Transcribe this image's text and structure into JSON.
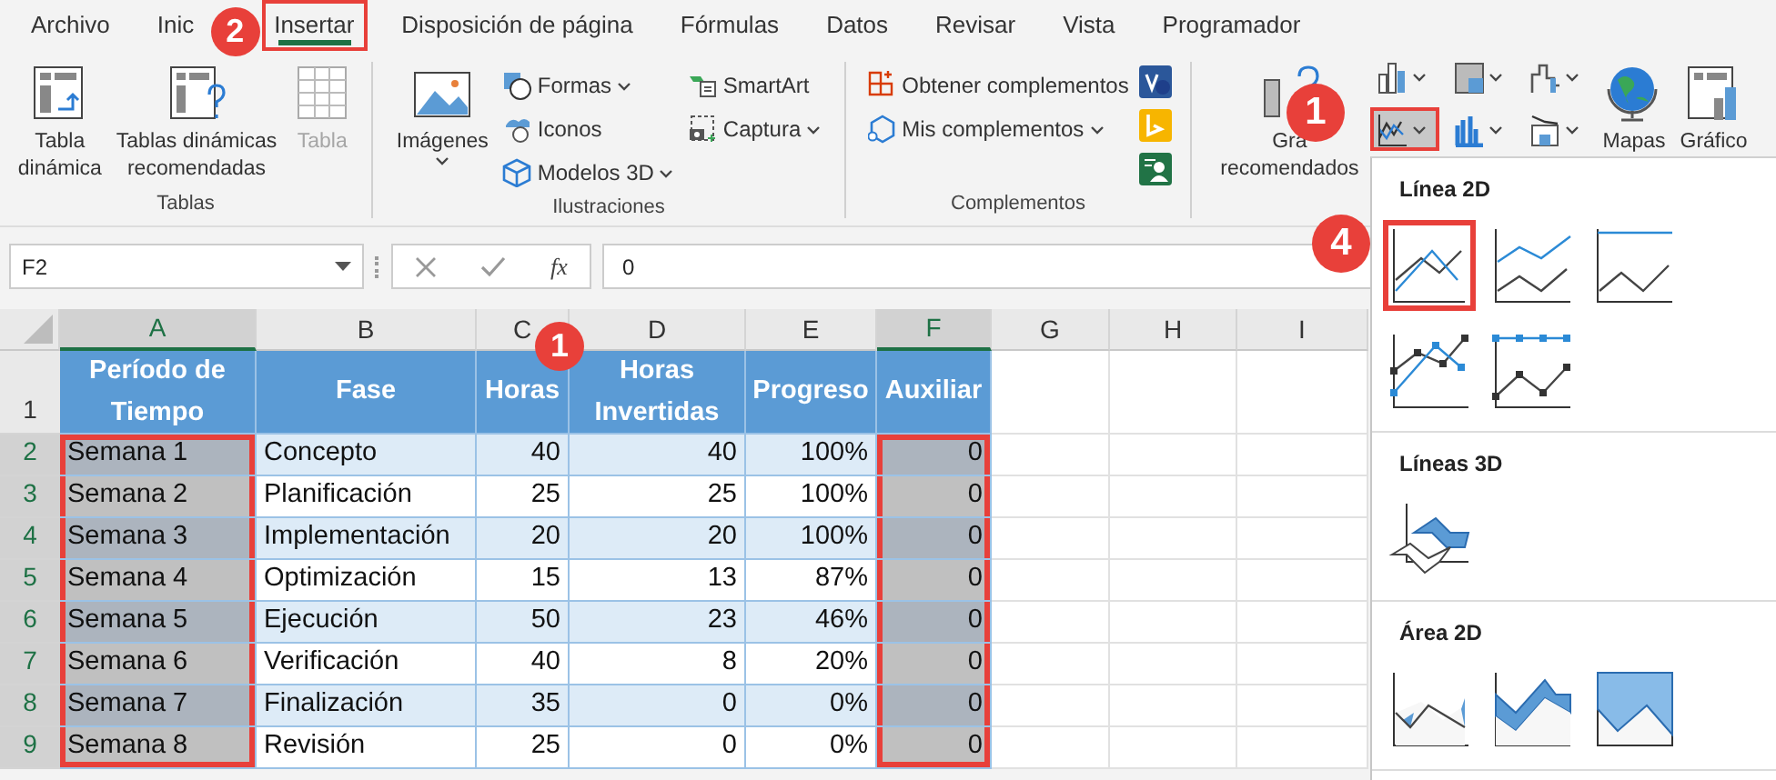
{
  "tabs": [
    {
      "label": "Archivo",
      "selected": false
    },
    {
      "label": "Inic",
      "selected": false
    },
    {
      "label": "Insertar",
      "selected": true
    },
    {
      "label": "Disposición de página",
      "selected": false
    },
    {
      "label": "Fórmulas",
      "selected": false
    },
    {
      "label": "Datos",
      "selected": false
    },
    {
      "label": "Revisar",
      "selected": false
    },
    {
      "label": "Vista",
      "selected": false
    },
    {
      "label": "Programador",
      "selected": false
    }
  ],
  "ribbon": {
    "groups": [
      {
        "label": "Tablas",
        "items": [
          {
            "kind": "large",
            "lines": [
              "Tabla",
              "dinámica"
            ],
            "disabled": false,
            "menu": false
          },
          {
            "kind": "large",
            "lines": [
              "Tablas dinámicas",
              "recomendadas"
            ],
            "disabled": false,
            "menu": false
          },
          {
            "kind": "large",
            "lines": [
              "Tabla"
            ],
            "disabled": true,
            "menu": false
          }
        ]
      },
      {
        "label": "Ilustraciones",
        "items": [
          {
            "kind": "large",
            "lines": [
              "Imágenes"
            ],
            "disabled": false,
            "menu": true
          },
          {
            "kind": "stack",
            "entries": [
              {
                "label": "Formas",
                "menu": true
              },
              {
                "label": "Iconos",
                "menu": false
              },
              {
                "label": "Modelos 3D",
                "menu": true
              }
            ]
          },
          {
            "kind": "stack",
            "entries": [
              {
                "label": "SmartArt",
                "menu": false
              },
              {
                "label": "Captura",
                "menu": true
              }
            ]
          }
        ]
      },
      {
        "label": "Complementos",
        "items": [
          {
            "kind": "stack",
            "entries": [
              {
                "label": "Obtener complementos",
                "menu": false
              },
              {
                "label": "Mis complementos",
                "menu": true
              }
            ]
          },
          {
            "kind": "apps"
          }
        ]
      },
      {
        "items": [
          {
            "kind": "large",
            "lines": [
              "Grá",
              "recomendados"
            ],
            "disabled": false,
            "menu": false
          },
          {
            "kind": "chart_grid",
            "buttons": [
              {
                "selected": false
              },
              {
                "selected": false
              },
              {
                "selected": false
              },
              {
                "selected": true
              },
              {
                "selected": false
              },
              {
                "selected": false
              }
            ]
          },
          {
            "kind": "large",
            "lines": [
              "Mapas"
            ],
            "disabled": false
          },
          {
            "kind": "large",
            "lines": [
              "Gráfico"
            ],
            "disabled": false
          }
        ]
      }
    ]
  },
  "formula_bar": {
    "name_box": "F2",
    "fx": "fx",
    "value": "0"
  },
  "sheet": {
    "columns": [
      {
        "label": "A",
        "selected": true
      },
      {
        "label": "B",
        "selected": false
      },
      {
        "label": "C",
        "selected": false
      },
      {
        "label": "D",
        "selected": false
      },
      {
        "label": "E",
        "selected": false
      },
      {
        "label": "F",
        "selected": true
      },
      {
        "label": "G",
        "selected": false
      },
      {
        "label": "H",
        "selected": false
      },
      {
        "label": "I",
        "selected": false
      }
    ],
    "rows": [
      {
        "header": "1",
        "selected": false,
        "cells": [
          "Período de Tiempo",
          "Fase",
          "Horas",
          "Horas Invertidas",
          "Progreso",
          "Auxiliar"
        ]
      },
      {
        "header": "2",
        "selected": true,
        "cells": [
          "Semana 1",
          "Concepto",
          "40",
          "40",
          "100%",
          "0"
        ]
      },
      {
        "header": "3",
        "selected": true,
        "cells": [
          "Semana 2",
          "Planificación",
          "25",
          "25",
          "100%",
          "0"
        ]
      },
      {
        "header": "4",
        "selected": true,
        "cells": [
          "Semana 3",
          "Implementación",
          "20",
          "20",
          "100%",
          "0"
        ]
      },
      {
        "header": "5",
        "selected": true,
        "cells": [
          "Semana 4",
          "Optimización",
          "15",
          "13",
          "87%",
          "0"
        ]
      },
      {
        "header": "6",
        "selected": true,
        "cells": [
          "Semana 5",
          "Ejecución",
          "50",
          "23",
          "46%",
          "0"
        ]
      },
      {
        "header": "7",
        "selected": true,
        "cells": [
          "Semana 6",
          "Verificación",
          "40",
          "8",
          "20%",
          "0"
        ]
      },
      {
        "header": "8",
        "selected": true,
        "cells": [
          "Semana 7",
          "Finalización",
          "35",
          "0",
          "0%",
          "0"
        ]
      },
      {
        "header": "9",
        "selected": true,
        "cells": [
          "Semana 8",
          "Revisión",
          "25",
          "0",
          "0%",
          "0"
        ]
      }
    ]
  },
  "chart_menu": {
    "sections": [
      {
        "title": "Línea 2D",
        "options": [
          {
            "selected": true
          },
          {
            "selected": false
          },
          {
            "selected": false
          },
          {
            "selected": false
          },
          {
            "selected": false
          }
        ]
      },
      {
        "title": "Líneas 3D",
        "options": [
          {
            "selected": false
          }
        ]
      },
      {
        "title": "Área 2D",
        "options": [
          {
            "selected": false
          },
          {
            "selected": false
          },
          {
            "selected": false
          }
        ]
      }
    ]
  },
  "callouts": [
    {
      "label": "2"
    },
    {
      "label": "1"
    },
    {
      "label": "4"
    },
    {
      "label": "1"
    }
  ]
}
